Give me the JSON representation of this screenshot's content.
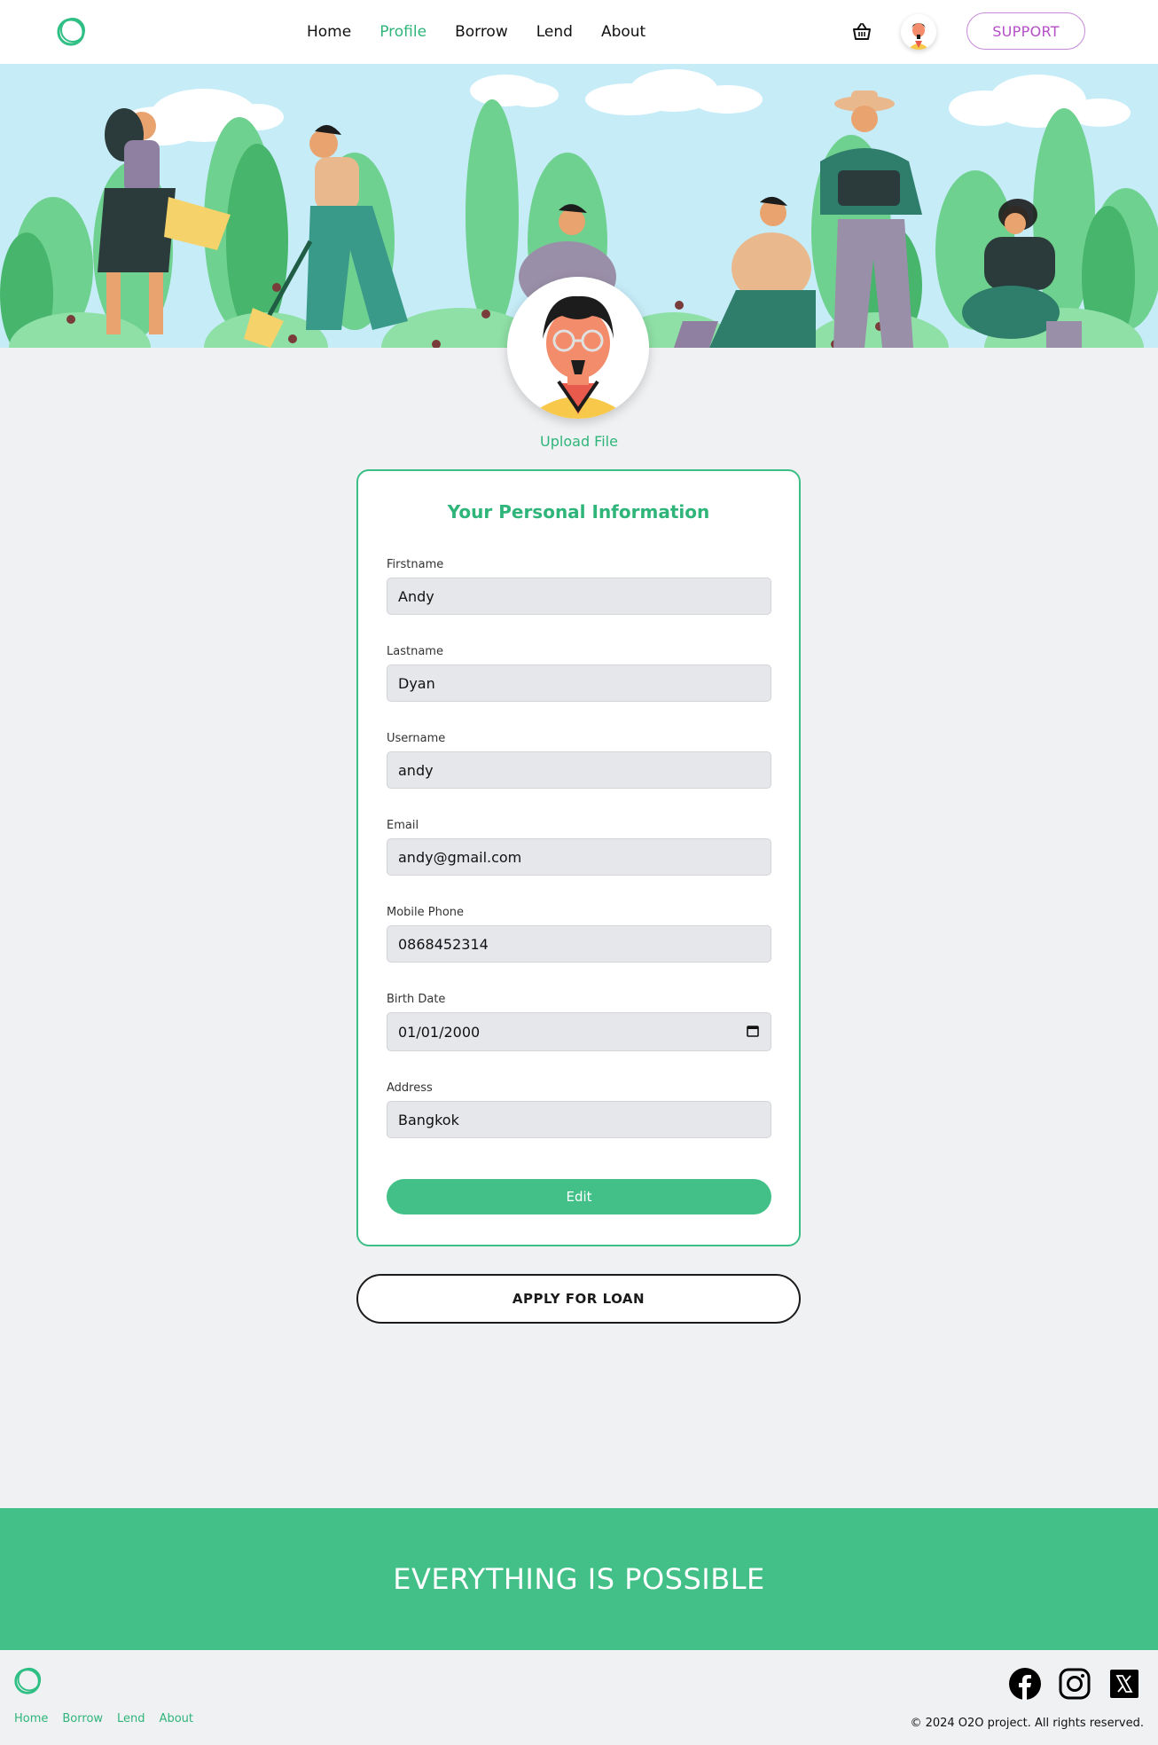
{
  "nav": {
    "links": [
      {
        "label": "Home",
        "active": false
      },
      {
        "label": "Profile",
        "active": true
      },
      {
        "label": "Borrow",
        "active": false
      },
      {
        "label": "Lend",
        "active": false
      },
      {
        "label": "About",
        "active": false
      }
    ],
    "support_label": "SUPPORT",
    "logo_icon": "ring-logo-icon",
    "cart_icon": "basket-icon"
  },
  "profile": {
    "upload_label": "Upload File"
  },
  "form": {
    "title": "Your Personal Information",
    "fields": [
      {
        "label": "Firstname",
        "value": "Andy"
      },
      {
        "label": "Lastname",
        "value": "Dyan"
      },
      {
        "label": "Username",
        "value": "andy"
      },
      {
        "label": "Email",
        "value": "andy@gmail.com"
      },
      {
        "label": "Mobile Phone",
        "value": "0868452314"
      },
      {
        "label": "Birth Date",
        "value": "01/01/2000"
      },
      {
        "label": "Address",
        "value": "Bangkok"
      }
    ],
    "edit_label": "Edit"
  },
  "apply_label": "APPLY FOR LOAN",
  "banner": {
    "text": "EVERYTHING IS POSSIBLE"
  },
  "footer": {
    "links": [
      "Home",
      "Borrow",
      "Lend",
      "About"
    ],
    "copyright": "© 2024 O2O project. All rights reserved.",
    "social_icons": [
      "facebook-icon",
      "instagram-icon",
      "x-icon"
    ]
  },
  "colors": {
    "accent": "#42c088",
    "accent_text": "#2fb57a",
    "support": "#b54fc7",
    "background": "#f0f1f3"
  }
}
